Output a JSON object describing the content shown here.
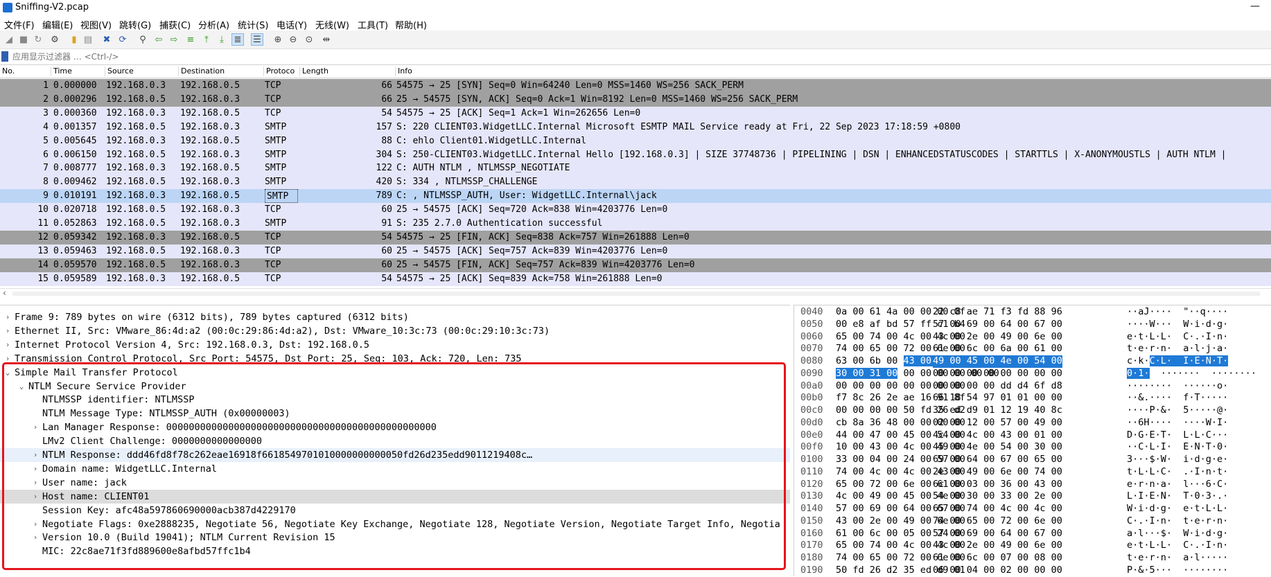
{
  "window": {
    "title": "Sniffing-V2.pcap",
    "minimize": "—"
  },
  "menu": [
    "文件(F)",
    "编辑(E)",
    "视图(V)",
    "跳转(G)",
    "捕获(C)",
    "分析(A)",
    "统计(S)",
    "电话(Y)",
    "无线(W)",
    "工具(T)",
    "帮助(H)"
  ],
  "toolbar_icons": [
    "start-capture-icon",
    "stop-capture-icon",
    "restart-capture-icon",
    "capture-options-icon",
    "open-file-icon",
    "save-file-icon",
    "close-file-icon",
    "reload-file-icon",
    "find-packet-icon",
    "go-back-icon",
    "go-forward-icon",
    "go-to-packet-icon",
    "go-first-icon",
    "go-last-icon",
    "autoscroll-icon",
    "colorize-icon",
    "zoom-in-icon",
    "zoom-out-icon",
    "zoom-normal-icon",
    "resize-columns-icon"
  ],
  "filter": {
    "placeholder": "应用显示过滤器 … <Ctrl-/>"
  },
  "packet_list": {
    "columns": [
      "No.",
      "Time",
      "Source",
      "Destination",
      "Protoco",
      "Length",
      "Info"
    ],
    "rows": [
      {
        "no": "1",
        "time": "0.000000",
        "src": "192.168.0.3",
        "dst": "192.168.0.5",
        "proto": "TCP",
        "len": "66",
        "info": "54575 → 25 [SYN] Seq=0 Win=64240 Len=0 MSS=1460 WS=256 SACK_PERM",
        "bg": "#a0a0a0"
      },
      {
        "no": "2",
        "time": "0.000296",
        "src": "192.168.0.5",
        "dst": "192.168.0.3",
        "proto": "TCP",
        "len": "66",
        "info": "25 → 54575 [SYN, ACK] Seq=0 Ack=1 Win=8192 Len=0 MSS=1460 WS=256 SACK_PERM",
        "bg": "#a0a0a0"
      },
      {
        "no": "3",
        "time": "0.000360",
        "src": "192.168.0.3",
        "dst": "192.168.0.5",
        "proto": "TCP",
        "len": "54",
        "info": "54575 → 25 [ACK] Seq=1 Ack=1 Win=262656 Len=0",
        "bg": "#e6e6fa"
      },
      {
        "no": "4",
        "time": "0.001357",
        "src": "192.168.0.5",
        "dst": "192.168.0.3",
        "proto": "SMTP",
        "len": "157",
        "info": "S: 220 CLIENT03.WidgetLLC.Internal Microsoft ESMTP MAIL Service ready at Fri, 22 Sep 2023 17:18:59 +0800",
        "bg": "#e6e6fa"
      },
      {
        "no": "5",
        "time": "0.005645",
        "src": "192.168.0.3",
        "dst": "192.168.0.5",
        "proto": "SMTP",
        "len": "88",
        "info": "C: ehlo Client01.WidgetLLC.Internal",
        "bg": "#e6e6fa"
      },
      {
        "no": "6",
        "time": "0.006150",
        "src": "192.168.0.5",
        "dst": "192.168.0.3",
        "proto": "SMTP",
        "len": "304",
        "info": "S: 250-CLIENT03.WidgetLLC.Internal Hello [192.168.0.3] | SIZE 37748736 | PIPELINING | DSN | ENHANCEDSTATUSCODES | STARTTLS | X-ANONYMOUSTLS | AUTH NTLM |",
        "bg": "#e6e6fa"
      },
      {
        "no": "7",
        "time": "0.008777",
        "src": "192.168.0.3",
        "dst": "192.168.0.5",
        "proto": "SMTP",
        "len": "122",
        "info": "C: AUTH NTLM , NTLMSSP_NEGOTIATE",
        "bg": "#e6e6fa"
      },
      {
        "no": "8",
        "time": "0.009462",
        "src": "192.168.0.5",
        "dst": "192.168.0.3",
        "proto": "SMTP",
        "len": "420",
        "info": "S: 334 , NTLMSSP_CHALLENGE",
        "bg": "#e6e6fa"
      },
      {
        "no": "9",
        "time": "0.010191",
        "src": "192.168.0.3",
        "dst": "192.168.0.5",
        "proto": "SMTP",
        "len": "789",
        "info": "C: , NTLMSSP_AUTH, User: WidgetLLC.Internal\\jack",
        "bg": "#bcd5f5",
        "selected": true
      },
      {
        "no": "10",
        "time": "0.020718",
        "src": "192.168.0.5",
        "dst": "192.168.0.3",
        "proto": "TCP",
        "len": "60",
        "info": "25 → 54575 [ACK] Seq=720 Ack=838 Win=4203776 Len=0",
        "bg": "#e6e6fa"
      },
      {
        "no": "11",
        "time": "0.052863",
        "src": "192.168.0.5",
        "dst": "192.168.0.3",
        "proto": "SMTP",
        "len": "91",
        "info": "S: 235 2.7.0 Authentication successful",
        "bg": "#e6e6fa"
      },
      {
        "no": "12",
        "time": "0.059342",
        "src": "192.168.0.3",
        "dst": "192.168.0.5",
        "proto": "TCP",
        "len": "54",
        "info": "54575 → 25 [FIN, ACK] Seq=838 Ack=757 Win=261888 Len=0",
        "bg": "#a0a0a0"
      },
      {
        "no": "13",
        "time": "0.059463",
        "src": "192.168.0.5",
        "dst": "192.168.0.3",
        "proto": "TCP",
        "len": "60",
        "info": "25 → 54575 [ACK] Seq=757 Ack=839 Win=4203776 Len=0",
        "bg": "#e6e6fa"
      },
      {
        "no": "14",
        "time": "0.059570",
        "src": "192.168.0.5",
        "dst": "192.168.0.3",
        "proto": "TCP",
        "len": "60",
        "info": "25 → 54575 [FIN, ACK] Seq=757 Ack=839 Win=4203776 Len=0",
        "bg": "#a0a0a0"
      },
      {
        "no": "15",
        "time": "0.059589",
        "src": "192.168.0.3",
        "dst": "192.168.0.5",
        "proto": "TCP",
        "len": "54",
        "info": "54575 → 25 [ACK] Seq=839 Ack=758 Win=261888 Len=0",
        "bg": "#e6e6fa"
      }
    ]
  },
  "details": [
    {
      "indent": 0,
      "arrow": "›",
      "text": "Frame 9: 789 bytes on wire (6312 bits), 789 bytes captured (6312 bits)"
    },
    {
      "indent": 0,
      "arrow": "›",
      "text": "Ethernet II, Src: VMware_86:4d:a2 (00:0c:29:86:4d:a2), Dst: VMware_10:3c:73 (00:0c:29:10:3c:73)"
    },
    {
      "indent": 0,
      "arrow": "›",
      "text": "Internet Protocol Version 4, Src: 192.168.0.3, Dst: 192.168.0.5"
    },
    {
      "indent": 0,
      "arrow": "›",
      "text": "Transmission Control Protocol, Src Port: 54575, Dst Port: 25, Seq: 103, Ack: 720, Len: 735"
    },
    {
      "indent": 0,
      "arrow": "⌄",
      "text": "Simple Mail Transfer Protocol"
    },
    {
      "indent": 1,
      "arrow": "⌄",
      "text": "NTLM Secure Service Provider"
    },
    {
      "indent": 2,
      "arrow": "",
      "text": "NTLMSSP identifier: NTLMSSP"
    },
    {
      "indent": 2,
      "arrow": "",
      "text": "NTLM Message Type: NTLMSSP_AUTH (0x00000003)"
    },
    {
      "indent": 2,
      "arrow": "›",
      "text": "Lan Manager Response: 000000000000000000000000000000000000000000000000"
    },
    {
      "indent": 2,
      "arrow": "",
      "text": "LMv2 Client Challenge: 0000000000000000"
    },
    {
      "indent": 2,
      "arrow": "›",
      "text": "NTLM Response: ddd46fd8f78c262eae16918f6618549701010000000000050fd26d235edd9011219408c…",
      "hl": "light"
    },
    {
      "indent": 2,
      "arrow": "›",
      "text": "Domain name: WidgetLLC.Internal"
    },
    {
      "indent": 2,
      "arrow": "›",
      "text": "User name: jack"
    },
    {
      "indent": 2,
      "arrow": "›",
      "text": "Host name: CLIENT01",
      "hl": "grey"
    },
    {
      "indent": 2,
      "arrow": "",
      "text": "Session Key: afc48a597860690000acb387d4229170"
    },
    {
      "indent": 2,
      "arrow": "›",
      "text": "Negotiate Flags: 0xe2888235, Negotiate 56, Negotiate Key Exchange, Negotiate 128, Negotiate Version, Negotiate Target Info, Negotia"
    },
    {
      "indent": 2,
      "arrow": "›",
      "text": "Version 10.0 (Build 19041); NTLM Current Revision 15"
    },
    {
      "indent": 2,
      "arrow": "",
      "text": "MIC: 22c8ae71f3fd889600e8afbd57ffc1b4"
    }
  ],
  "hex": [
    {
      "off": "0040",
      "b1": "0a 00 61 4a 00 00 00 0f",
      "b2": "22 c8 ae 71 f3 fd 88 96",
      "asc": "··aJ····  \"··q····"
    },
    {
      "off": "0050",
      "b1": "00 e8 af bd 57 ff c1 b4",
      "b2": "57 00 69 00 64 00 67 00",
      "asc": "····W···  W·i·d·g·"
    },
    {
      "off": "0060",
      "b1": "65 00 74 00 4c 00 4c 00",
      "b2": "43 00 2e 00 49 00 6e 00",
      "asc": "e·t·L·L·  C·.·I·n·"
    },
    {
      "off": "0070",
      "b1": "74 00 65 00 72 00 6e 00",
      "b2": "61 00 6c 00 6a 00 61 00",
      "asc": "t·e·r·n·  a·l·j·a·"
    },
    {
      "off": "0080",
      "b1": "63 00 6b 00 ",
      "b1sel": "43 00 4c 00",
      "b2": "",
      "b2sel": "49 00 45 00 4e 00 54 00",
      "asc": "c·k·",
      "ascsel": "C·L·  I·E·N·T·"
    },
    {
      "off": "0090",
      "b1": " 00 00 00 00 00 00",
      "b1sel": "30 00 31 00",
      "b2": "00 00 00 00 00 00 00 00",
      "asc": "  ·······  ········",
      "ascsel": "0·1·"
    },
    {
      "off": "00a0",
      "b1": "00 00 00 00 00 00 00 00",
      "b2": "00 00 00 00 dd d4 6f d8",
      "asc": "········  ······o·"
    },
    {
      "off": "00b0",
      "b1": "f7 8c 26 2e ae 16 91 8f",
      "b2": "66 18 54 97 01 01 00 00",
      "asc": "··&.····  f·T·····"
    },
    {
      "off": "00c0",
      "b1": "00 00 00 00 50 fd 26 d2",
      "b2": "35 ed d9 01 12 19 40 8c",
      "asc": "····P·&·  5·····@·"
    },
    {
      "off": "00d0",
      "b1": "cb 8a 36 48 00 00 00 00",
      "b2": "02 00 12 00 57 00 49 00",
      "asc": "··6H····  ····W·I·"
    },
    {
      "off": "00e0",
      "b1": "44 00 47 00 45 00 54 00",
      "b2": "4c 00 4c 00 43 00 01 00",
      "asc": "D·G·E·T·  L·L·C···"
    },
    {
      "off": "00f0",
      "b1": "10 00 43 00 4c 00 49 00",
      "b2": "45 00 4e 00 54 00 30 00",
      "asc": "··C·L·I·  E·N·T·0·"
    },
    {
      "off": "0100",
      "b1": "33 00 04 00 24 00 57 00",
      "b2": "69 00 64 00 67 00 65 00",
      "asc": "3···$·W·  i·d·g·e·"
    },
    {
      "off": "0110",
      "b1": "74 00 4c 00 4c 00 43 00",
      "b2": "2e 00 49 00 6e 00 74 00",
      "asc": "t·L·L·C·  .·I·n·t·"
    },
    {
      "off": "0120",
      "b1": "65 00 72 00 6e 00 61 00",
      "b2": "6c 00 03 00 36 00 43 00",
      "asc": "e·r·n·a·  l···6·C·"
    },
    {
      "off": "0130",
      "b1": "4c 00 49 00 45 00 4e 00",
      "b2": "54 00 30 00 33 00 2e 00",
      "asc": "L·I·E·N·  T·0·3·.·"
    },
    {
      "off": "0140",
      "b1": "57 00 69 00 64 00 67 00",
      "b2": "65 00 74 00 4c 00 4c 00",
      "asc": "W·i·d·g·  e·t·L·L·"
    },
    {
      "off": "0150",
      "b1": "43 00 2e 00 49 00 6e 00",
      "b2": "74 00 65 00 72 00 6e 00",
      "asc": "C·.·I·n·  t·e·r·n·"
    },
    {
      "off": "0160",
      "b1": "61 00 6c 00 05 00 24 00",
      "b2": "57 00 69 00 64 00 67 00",
      "asc": "a·l···$·  W·i·d·g·"
    },
    {
      "off": "0170",
      "b1": "65 00 74 00 4c 00 4c 00",
      "b2": "43 00 2e 00 49 00 6e 00",
      "asc": "e·t·L·L·  C·.·I·n·"
    },
    {
      "off": "0180",
      "b1": "74 00 65 00 72 00 6e 00",
      "b2": "61 00 6c 00 07 00 08 00",
      "asc": "t·e·r·n·  a·l·····"
    },
    {
      "off": "0190",
      "b1": "50 fd 26 d2 35 ed d9 01",
      "b2": "06 00 04 00 02 00 00 00",
      "asc": "P·&·5···  ········"
    }
  ]
}
